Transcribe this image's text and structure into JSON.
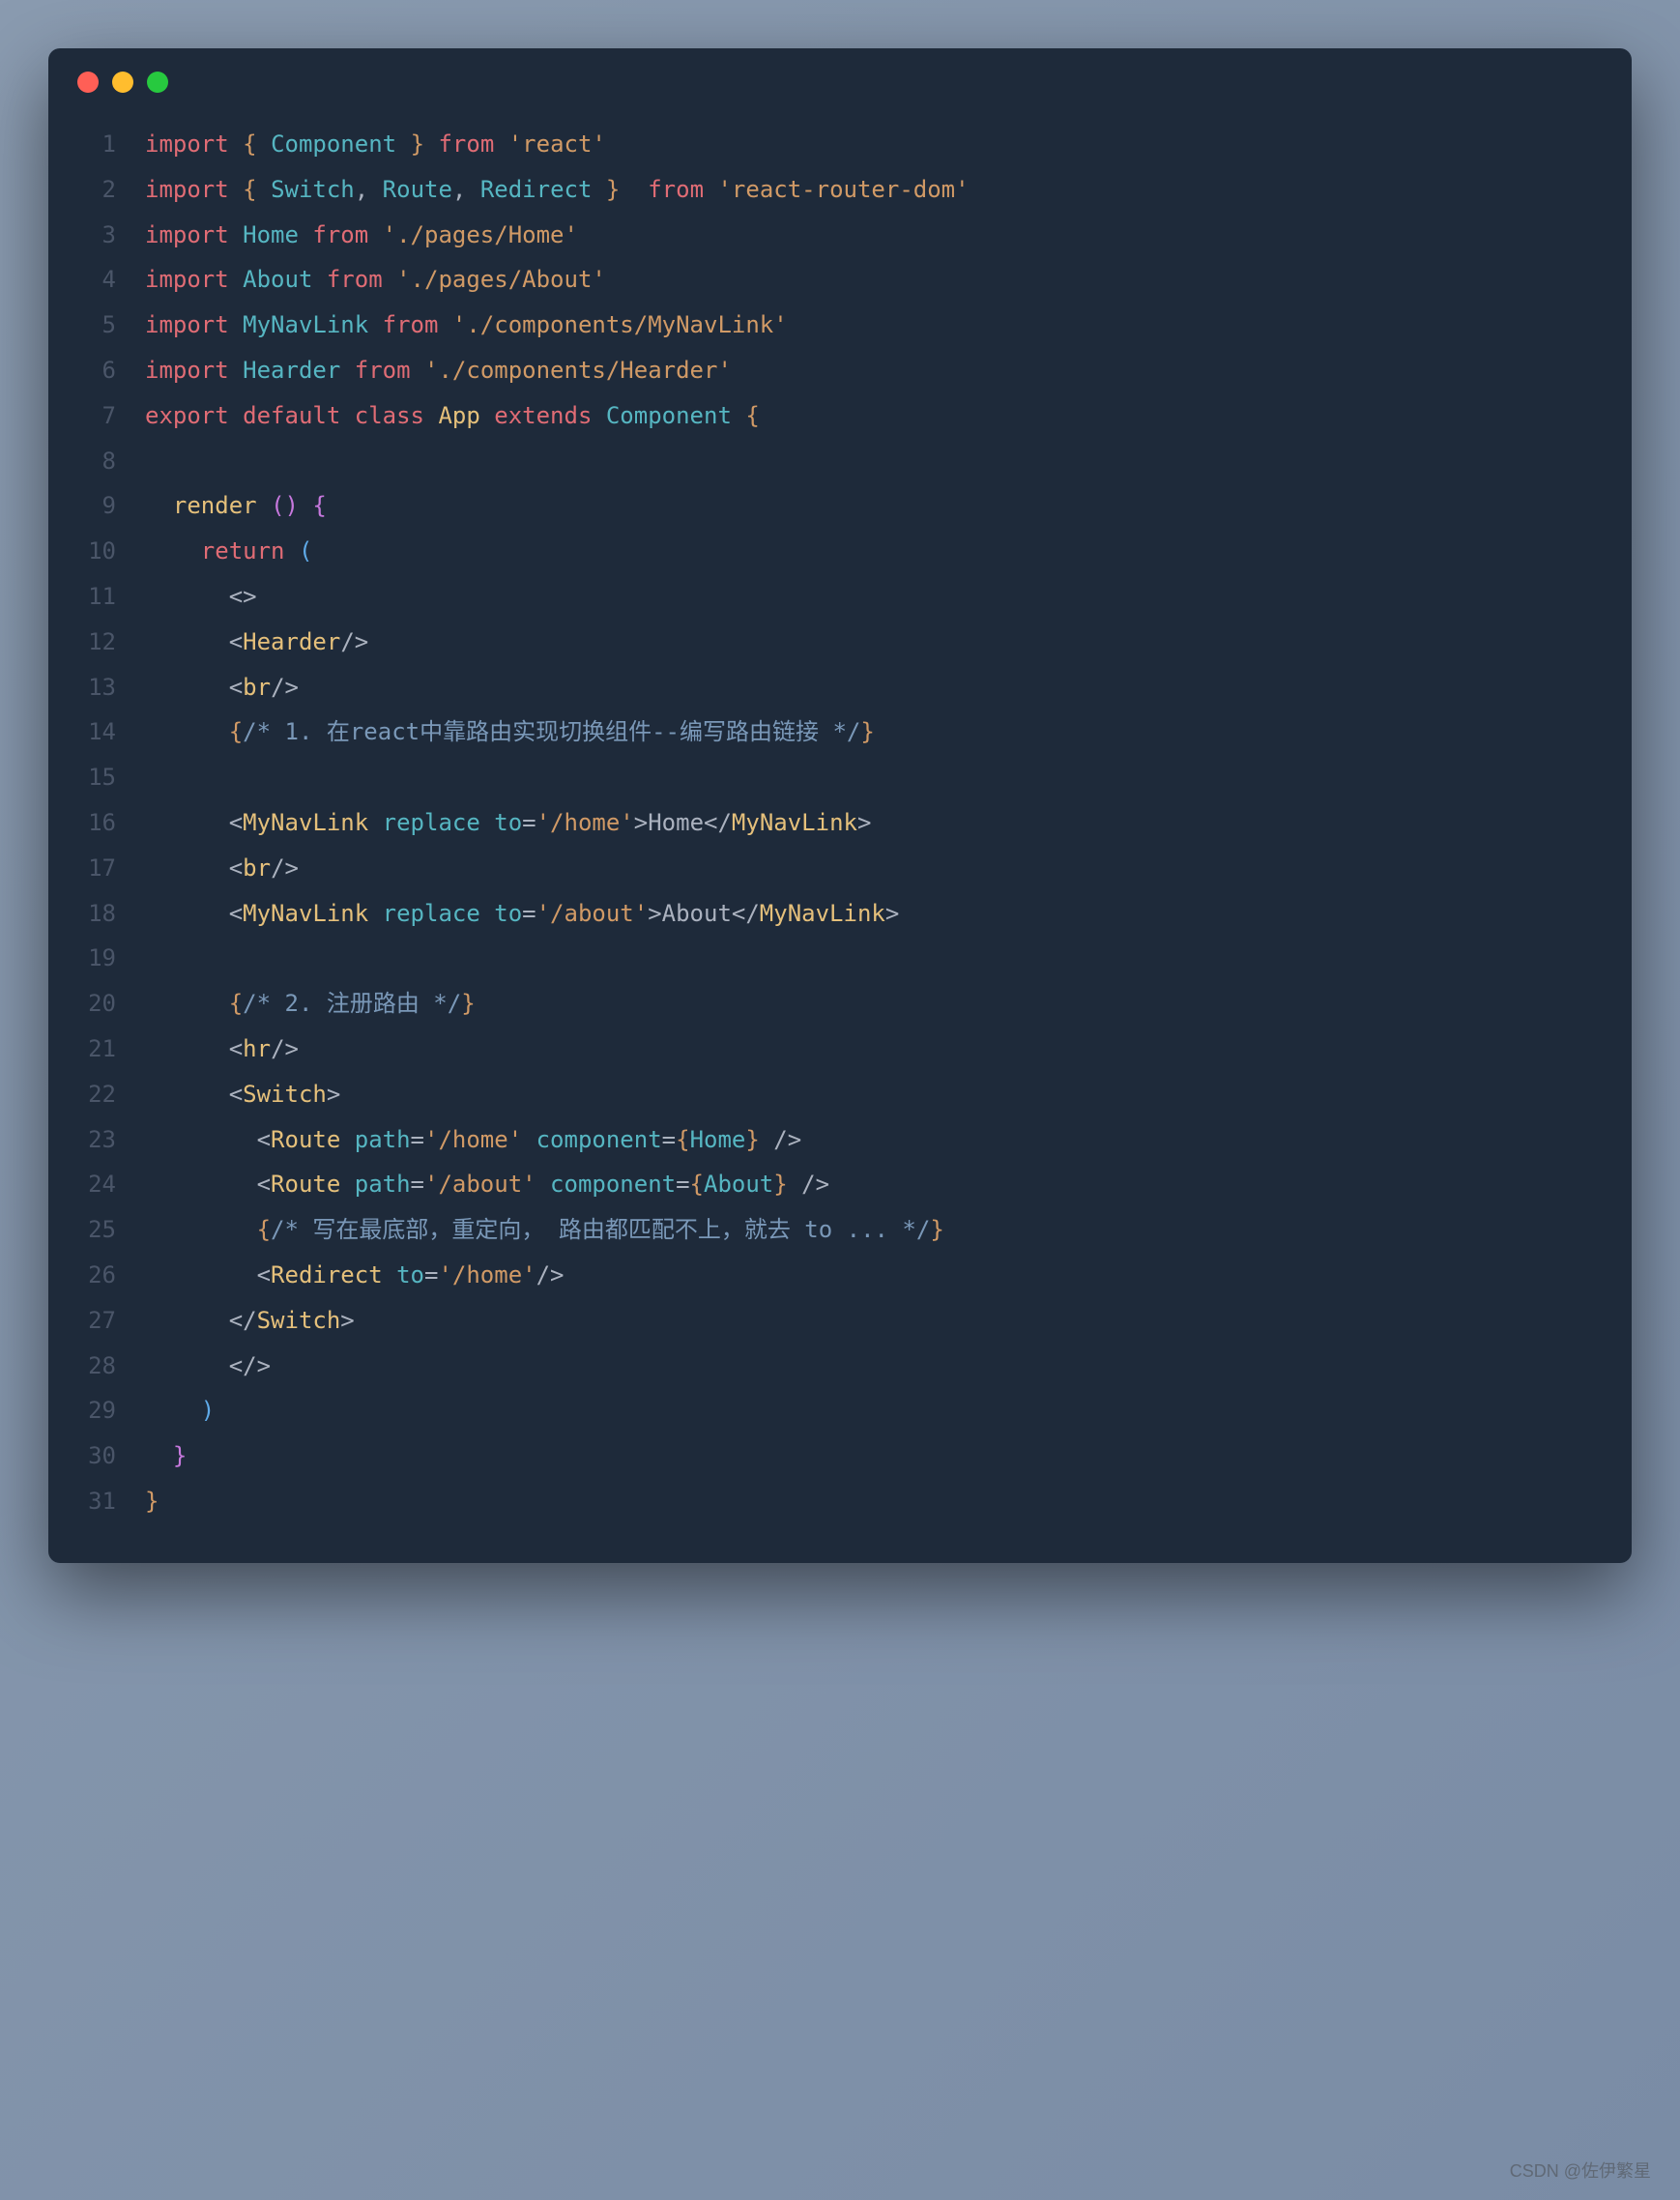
{
  "window": {
    "dots": [
      "red",
      "yellow",
      "green"
    ]
  },
  "code": {
    "lines": [
      {
        "n": "1",
        "tokens": [
          {
            "c": "kw-import",
            "t": "import "
          },
          {
            "c": "brace-yellow",
            "t": "{"
          },
          {
            "c": "plain",
            "t": " "
          },
          {
            "c": "ident",
            "t": "Component"
          },
          {
            "c": "plain",
            "t": " "
          },
          {
            "c": "brace-yellow",
            "t": "}"
          },
          {
            "c": "plain",
            "t": " "
          },
          {
            "c": "kw-from",
            "t": "from"
          },
          {
            "c": "plain",
            "t": " "
          },
          {
            "c": "str",
            "t": "'react'"
          }
        ]
      },
      {
        "n": "2",
        "tokens": [
          {
            "c": "kw-import",
            "t": "import "
          },
          {
            "c": "brace-yellow",
            "t": "{"
          },
          {
            "c": "plain",
            "t": " "
          },
          {
            "c": "ident",
            "t": "Switch"
          },
          {
            "c": "plain",
            "t": ", "
          },
          {
            "c": "ident",
            "t": "Route"
          },
          {
            "c": "plain",
            "t": ", "
          },
          {
            "c": "ident",
            "t": "Redirect"
          },
          {
            "c": "plain",
            "t": " "
          },
          {
            "c": "brace-yellow",
            "t": "}"
          },
          {
            "c": "plain",
            "t": "  "
          },
          {
            "c": "kw-from",
            "t": "from"
          },
          {
            "c": "plain",
            "t": " "
          },
          {
            "c": "str",
            "t": "'react-router-dom'"
          }
        ]
      },
      {
        "n": "3",
        "tokens": [
          {
            "c": "kw-import",
            "t": "import "
          },
          {
            "c": "ident",
            "t": "Home"
          },
          {
            "c": "plain",
            "t": " "
          },
          {
            "c": "kw-from",
            "t": "from"
          },
          {
            "c": "plain",
            "t": " "
          },
          {
            "c": "str",
            "t": "'./pages/Home'"
          }
        ]
      },
      {
        "n": "4",
        "tokens": [
          {
            "c": "kw-import",
            "t": "import "
          },
          {
            "c": "ident",
            "t": "About"
          },
          {
            "c": "plain",
            "t": " "
          },
          {
            "c": "kw-from",
            "t": "from"
          },
          {
            "c": "plain",
            "t": " "
          },
          {
            "c": "str",
            "t": "'./pages/About'"
          }
        ]
      },
      {
        "n": "5",
        "tokens": [
          {
            "c": "kw-import",
            "t": "import "
          },
          {
            "c": "ident",
            "t": "MyNavLink"
          },
          {
            "c": "plain",
            "t": " "
          },
          {
            "c": "kw-from",
            "t": "from"
          },
          {
            "c": "plain",
            "t": " "
          },
          {
            "c": "str",
            "t": "'./components/MyNavLink'"
          }
        ]
      },
      {
        "n": "6",
        "tokens": [
          {
            "c": "kw-import",
            "t": "import "
          },
          {
            "c": "ident",
            "t": "Hearder"
          },
          {
            "c": "plain",
            "t": " "
          },
          {
            "c": "kw-from",
            "t": "from"
          },
          {
            "c": "plain",
            "t": " "
          },
          {
            "c": "str",
            "t": "'./components/Hearder'"
          }
        ]
      },
      {
        "n": "7",
        "tokens": [
          {
            "c": "kw-export",
            "t": "export "
          },
          {
            "c": "kw-default",
            "t": "default "
          },
          {
            "c": "kw-class",
            "t": "class "
          },
          {
            "c": "fn",
            "t": "App "
          },
          {
            "c": "kw-extends",
            "t": "extends "
          },
          {
            "c": "ident",
            "t": "Component"
          },
          {
            "c": "plain",
            "t": " "
          },
          {
            "c": "brace-yellow",
            "t": "{"
          }
        ]
      },
      {
        "n": "8",
        "tokens": []
      },
      {
        "n": "9",
        "tokens": [
          {
            "c": "plain",
            "t": "  "
          },
          {
            "c": "fn",
            "t": "render "
          },
          {
            "c": "brace-purple",
            "t": "()"
          },
          {
            "c": "plain",
            "t": " "
          },
          {
            "c": "brace-purple",
            "t": "{"
          }
        ]
      },
      {
        "n": "10",
        "tokens": [
          {
            "c": "plain",
            "t": "    "
          },
          {
            "c": "kw-return",
            "t": "return "
          },
          {
            "c": "brace-blue",
            "t": "("
          }
        ]
      },
      {
        "n": "11",
        "tokens": [
          {
            "c": "plain",
            "t": "      <>"
          }
        ]
      },
      {
        "n": "12",
        "tokens": [
          {
            "c": "plain",
            "t": "      <"
          },
          {
            "c": "tag",
            "t": "Hearder"
          },
          {
            "c": "plain",
            "t": "/>"
          }
        ]
      },
      {
        "n": "13",
        "tokens": [
          {
            "c": "plain",
            "t": "      <"
          },
          {
            "c": "tag",
            "t": "br"
          },
          {
            "c": "plain",
            "t": "/>"
          }
        ]
      },
      {
        "n": "14",
        "tokens": [
          {
            "c": "plain",
            "t": "      "
          },
          {
            "c": "brace-yellow",
            "t": "{"
          },
          {
            "c": "comment",
            "t": "/* 1. 在react中靠路由实现切换组件--编写路由链接 */"
          },
          {
            "c": "brace-yellow",
            "t": "}"
          }
        ]
      },
      {
        "n": "15",
        "tokens": []
      },
      {
        "n": "16",
        "tokens": [
          {
            "c": "plain",
            "t": "      <"
          },
          {
            "c": "tag",
            "t": "MyNavLink "
          },
          {
            "c": "attr",
            "t": "replace "
          },
          {
            "c": "attr",
            "t": "to"
          },
          {
            "c": "plain",
            "t": "="
          },
          {
            "c": "str",
            "t": "'/home'"
          },
          {
            "c": "plain",
            "t": ">Home</"
          },
          {
            "c": "tag",
            "t": "MyNavLink"
          },
          {
            "c": "plain",
            "t": ">"
          }
        ]
      },
      {
        "n": "17",
        "tokens": [
          {
            "c": "plain",
            "t": "      <"
          },
          {
            "c": "tag",
            "t": "br"
          },
          {
            "c": "plain",
            "t": "/>"
          }
        ]
      },
      {
        "n": "18",
        "tokens": [
          {
            "c": "plain",
            "t": "      <"
          },
          {
            "c": "tag",
            "t": "MyNavLink "
          },
          {
            "c": "attr",
            "t": "replace "
          },
          {
            "c": "attr",
            "t": "to"
          },
          {
            "c": "plain",
            "t": "="
          },
          {
            "c": "str",
            "t": "'/about'"
          },
          {
            "c": "plain",
            "t": ">About</"
          },
          {
            "c": "tag",
            "t": "MyNavLink"
          },
          {
            "c": "plain",
            "t": ">"
          }
        ]
      },
      {
        "n": "19",
        "tokens": []
      },
      {
        "n": "20",
        "tokens": [
          {
            "c": "plain",
            "t": "      "
          },
          {
            "c": "brace-yellow",
            "t": "{"
          },
          {
            "c": "comment",
            "t": "/* 2. 注册路由 */"
          },
          {
            "c": "brace-yellow",
            "t": "}"
          }
        ]
      },
      {
        "n": "21",
        "tokens": [
          {
            "c": "plain",
            "t": "      <"
          },
          {
            "c": "tag",
            "t": "hr"
          },
          {
            "c": "plain",
            "t": "/>"
          }
        ]
      },
      {
        "n": "22",
        "tokens": [
          {
            "c": "plain",
            "t": "      <"
          },
          {
            "c": "tag",
            "t": "Switch"
          },
          {
            "c": "plain",
            "t": ">"
          }
        ]
      },
      {
        "n": "23",
        "tokens": [
          {
            "c": "plain",
            "t": "        <"
          },
          {
            "c": "tag",
            "t": "Route "
          },
          {
            "c": "attr",
            "t": "path"
          },
          {
            "c": "plain",
            "t": "="
          },
          {
            "c": "str",
            "t": "'/home'"
          },
          {
            "c": "plain",
            "t": " "
          },
          {
            "c": "attr",
            "t": "component"
          },
          {
            "c": "plain",
            "t": "="
          },
          {
            "c": "brace-yellow",
            "t": "{"
          },
          {
            "c": "ident",
            "t": "Home"
          },
          {
            "c": "brace-yellow",
            "t": "}"
          },
          {
            "c": "plain",
            "t": " />"
          }
        ]
      },
      {
        "n": "24",
        "tokens": [
          {
            "c": "plain",
            "t": "        <"
          },
          {
            "c": "tag",
            "t": "Route "
          },
          {
            "c": "attr",
            "t": "path"
          },
          {
            "c": "plain",
            "t": "="
          },
          {
            "c": "str",
            "t": "'/about'"
          },
          {
            "c": "plain",
            "t": " "
          },
          {
            "c": "attr",
            "t": "component"
          },
          {
            "c": "plain",
            "t": "="
          },
          {
            "c": "brace-yellow",
            "t": "{"
          },
          {
            "c": "ident",
            "t": "About"
          },
          {
            "c": "brace-yellow",
            "t": "}"
          },
          {
            "c": "plain",
            "t": " />"
          }
        ]
      },
      {
        "n": "25",
        "tokens": [
          {
            "c": "plain",
            "t": "        "
          },
          {
            "c": "brace-yellow",
            "t": "{"
          },
          {
            "c": "comment",
            "t": "/* 写在最底部，重定向， 路由都匹配不上，就去 to ... */"
          },
          {
            "c": "brace-yellow",
            "t": "}"
          }
        ]
      },
      {
        "n": "26",
        "tokens": [
          {
            "c": "plain",
            "t": "        <"
          },
          {
            "c": "tag",
            "t": "Redirect "
          },
          {
            "c": "attr",
            "t": "to"
          },
          {
            "c": "plain",
            "t": "="
          },
          {
            "c": "str",
            "t": "'/home'"
          },
          {
            "c": "plain",
            "t": "/>"
          }
        ]
      },
      {
        "n": "27",
        "tokens": [
          {
            "c": "plain",
            "t": "      </"
          },
          {
            "c": "tag",
            "t": "Switch"
          },
          {
            "c": "plain",
            "t": ">"
          }
        ]
      },
      {
        "n": "28",
        "tokens": [
          {
            "c": "plain",
            "t": "      </>"
          }
        ]
      },
      {
        "n": "29",
        "tokens": [
          {
            "c": "plain",
            "t": "    "
          },
          {
            "c": "brace-blue",
            "t": ")"
          }
        ]
      },
      {
        "n": "30",
        "tokens": [
          {
            "c": "plain",
            "t": "  "
          },
          {
            "c": "brace-purple",
            "t": "}"
          }
        ]
      },
      {
        "n": "31",
        "tokens": [
          {
            "c": "brace-yellow",
            "t": "}"
          }
        ]
      }
    ]
  },
  "watermark": "CSDN @佐伊繁星"
}
